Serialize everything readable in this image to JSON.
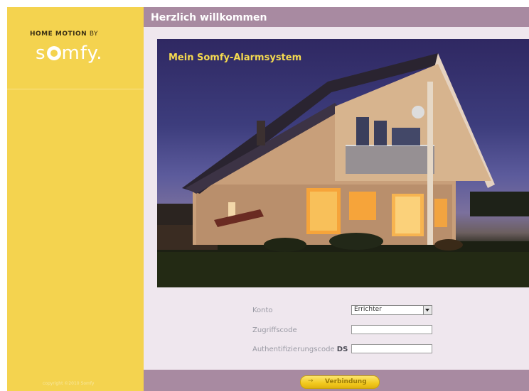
{
  "sidebar": {
    "brand_tagline": "HOME MOTION",
    "brand_by": "BY",
    "logo_text_s": "s",
    "logo_text_rest": "mfy.",
    "copyright": "copyright ©2010 Somfy"
  },
  "header": {
    "title": "Herzlich willkommen"
  },
  "hero": {
    "title": "Mein Somfy-Alarmsystem"
  },
  "form": {
    "account_label": "Konto",
    "account_selected": "Errichter",
    "access_code_label": "Zugriffscode",
    "access_code_value": "",
    "auth_code_label": "Authentifizierungscode",
    "auth_code_suffix": "DS",
    "auth_code_value": ""
  },
  "footer": {
    "connect_arrow": "→",
    "connect_label": "Verbindung"
  },
  "colors": {
    "sidebar_yellow": "#f4d34f",
    "header_mauve": "#a88aa1",
    "content_bg": "#efe7ee",
    "hero_title_yellow": "#f5da4f"
  }
}
